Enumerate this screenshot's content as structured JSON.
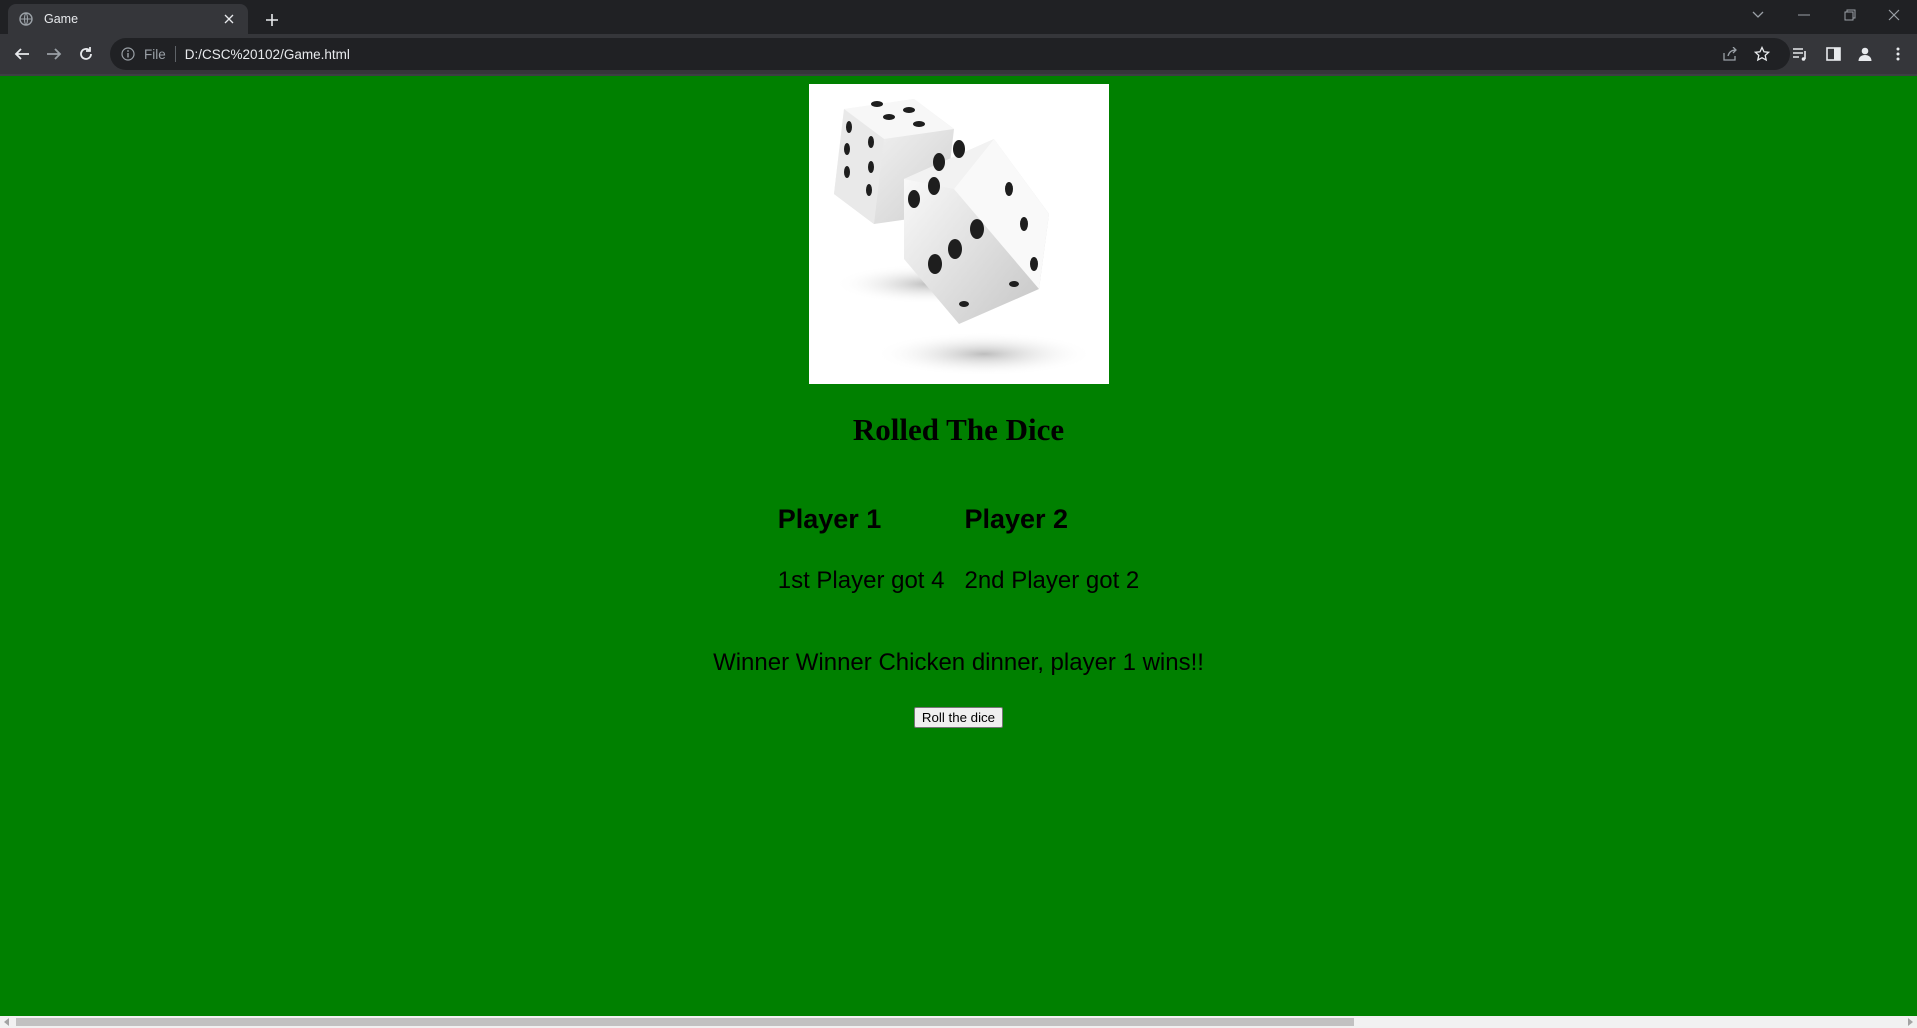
{
  "browser": {
    "tab_title": "Game",
    "url_scheme_label": "File",
    "url": "D:/CSC%20102/Game.html"
  },
  "page": {
    "background_color": "#008000",
    "title": "Rolled The Dice",
    "player1_heading": "Player 1",
    "player2_heading": "Player 2",
    "player1_result": "1st Player got 4",
    "player2_result": "2nd Player got 2",
    "winner_text": "Winner Winner Chicken dinner, player 1 wins!!",
    "roll_button_label": "Roll the dice",
    "dice_image_icon": "two-dice-icon"
  },
  "scrollbar": {
    "horizontal_thumb_fraction": 0.71
  }
}
